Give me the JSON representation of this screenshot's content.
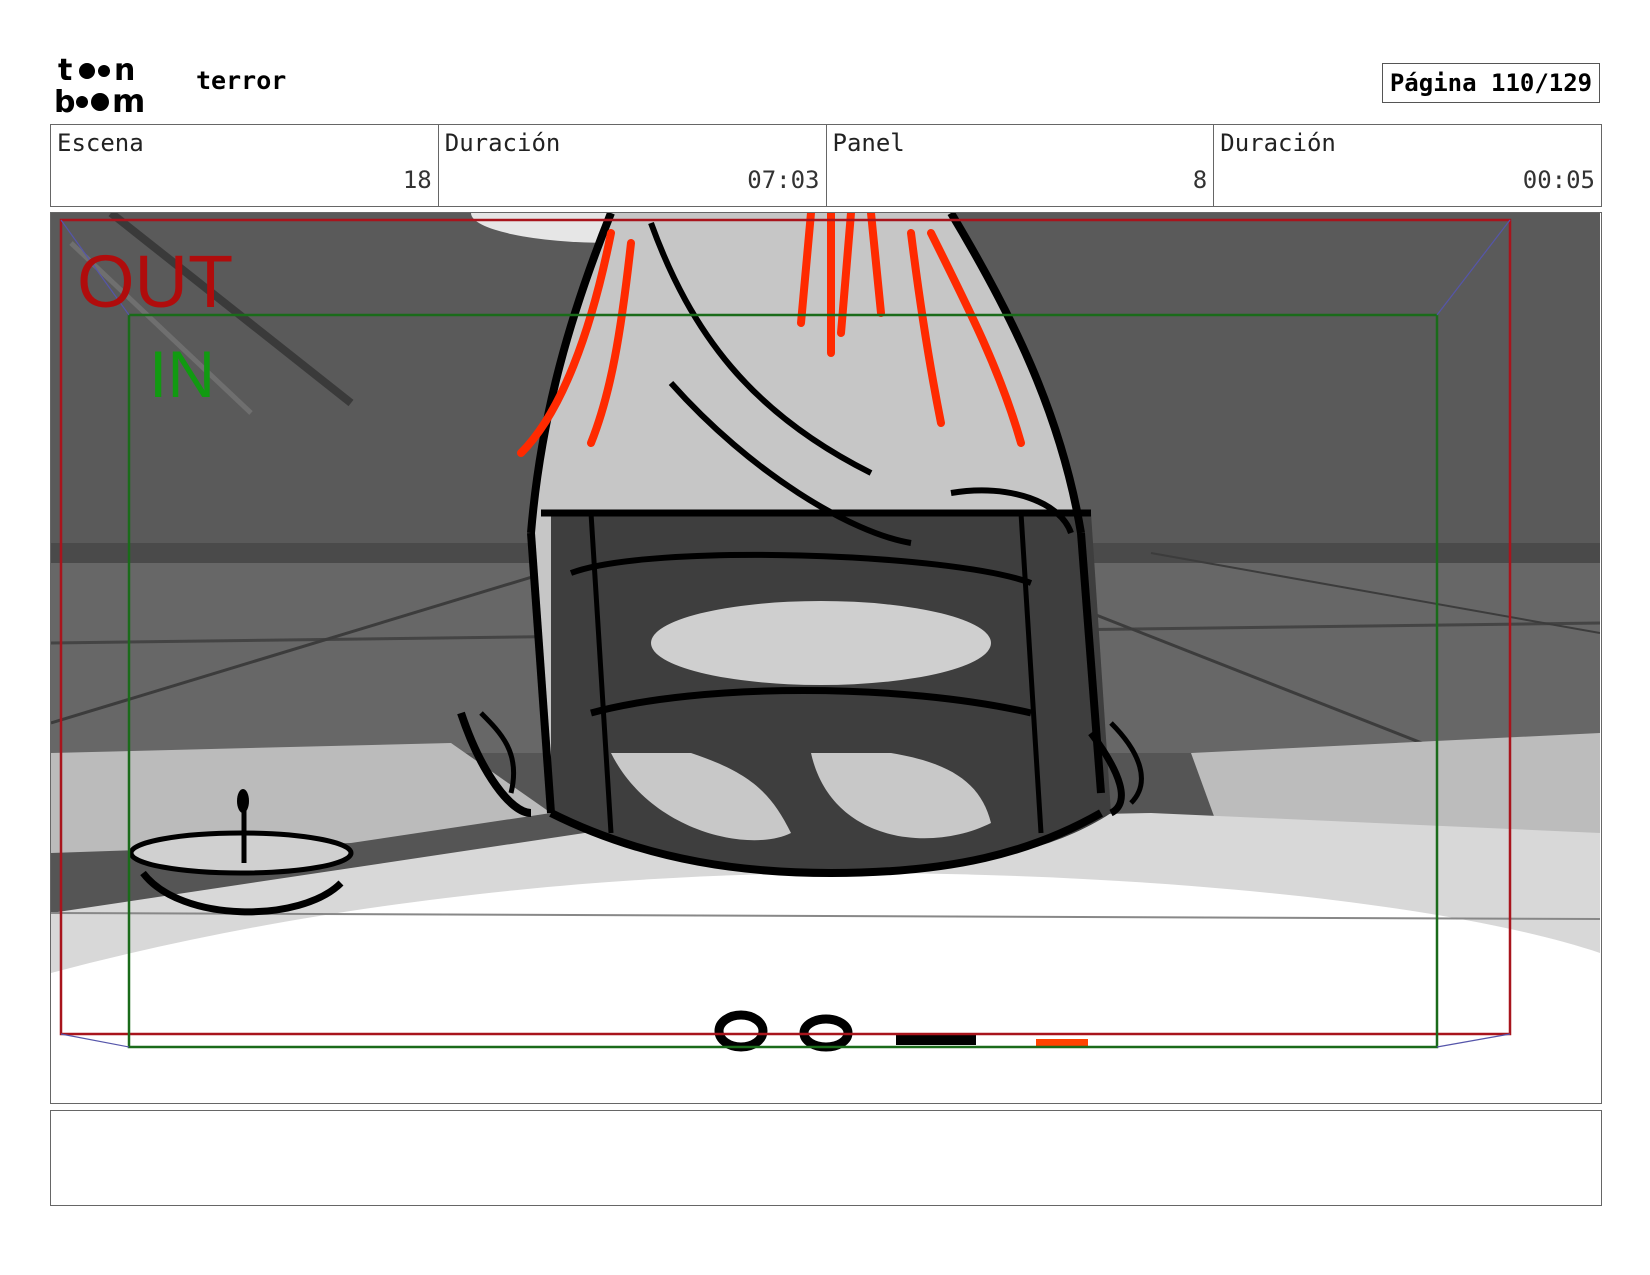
{
  "header": {
    "logo_text": "toon boom",
    "project_title": "terror",
    "page_label": "Página 110/129"
  },
  "info": [
    {
      "label": "Escena",
      "value": "18"
    },
    {
      "label": "Duración",
      "value": "07:03"
    },
    {
      "label": "Panel",
      "value": "8"
    },
    {
      "label": "Duración",
      "value": "00:05"
    }
  ],
  "panel": {
    "out_label": "OUT",
    "in_label": "IN",
    "frame_colors": {
      "out": "#a8141c",
      "in": "#1a6b1a",
      "accent": "#ff3300"
    }
  },
  "dialog": {
    "text": ""
  }
}
